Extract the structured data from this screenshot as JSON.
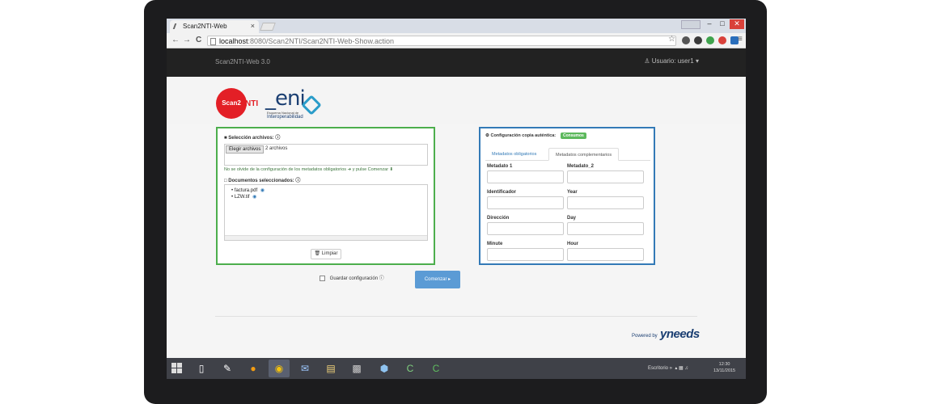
{
  "browser": {
    "tab_title": "Scan2NTI-Web",
    "tab_close": "×",
    "url_host": "localhost",
    "url_path": ":8080/Scan2NTI/Scan2NTI-Web-Show.action",
    "back": "←",
    "forward": "→",
    "reload": "C",
    "star": "☆",
    "menu": "≡",
    "win_min": "–",
    "win_max": "□",
    "win_close": "✕"
  },
  "navbar": {
    "brand": "Scan2NTI-Web 3.0",
    "user": "Usuario: user1",
    "user_caret": "▾"
  },
  "logos": {
    "scan_text": "Scan2",
    "nti_text": "NTI",
    "eni_text": "_eni",
    "eni_sub1": "Esquema Nacional de",
    "eni_sub2": "Interoperabilidad"
  },
  "selection": {
    "heading": "Selección archivos:",
    "choose_button": "Elegir archivos",
    "files_count": "2 archivos",
    "hint": "No se olvide de la configuración de los metadatos obligatorios ➜ y pulse Comenzar ⬇",
    "docs_heading": "Documentos seleccionados:",
    "documents": [
      "factura.pdf",
      "LZW.tif"
    ],
    "clear_button": "Limpiar"
  },
  "config": {
    "heading": "Configuración copia auténtica:",
    "badge": "Consumos",
    "tabs": [
      "Metadatos obligatorios",
      "Metadatos complementarios"
    ],
    "fields": [
      {
        "label": "Metadato 1",
        "value": ""
      },
      {
        "label": "Metadato_2",
        "value": ""
      },
      {
        "label": "Identificador",
        "value": ""
      },
      {
        "label": "Year",
        "value": ""
      },
      {
        "label": "Dirección",
        "value": ""
      },
      {
        "label": "Day",
        "value": ""
      },
      {
        "label": "Minute",
        "value": ""
      },
      {
        "label": "Hour",
        "value": ""
      }
    ]
  },
  "actions": {
    "save_config": "Guardar configuración",
    "start": "Comenzar"
  },
  "footer": {
    "powered_by": "Powered by",
    "yneeds": "yneeds"
  },
  "taskbar": {
    "desktop_label": "Escritorio",
    "time": "12:30",
    "date": "13/11/2015"
  }
}
